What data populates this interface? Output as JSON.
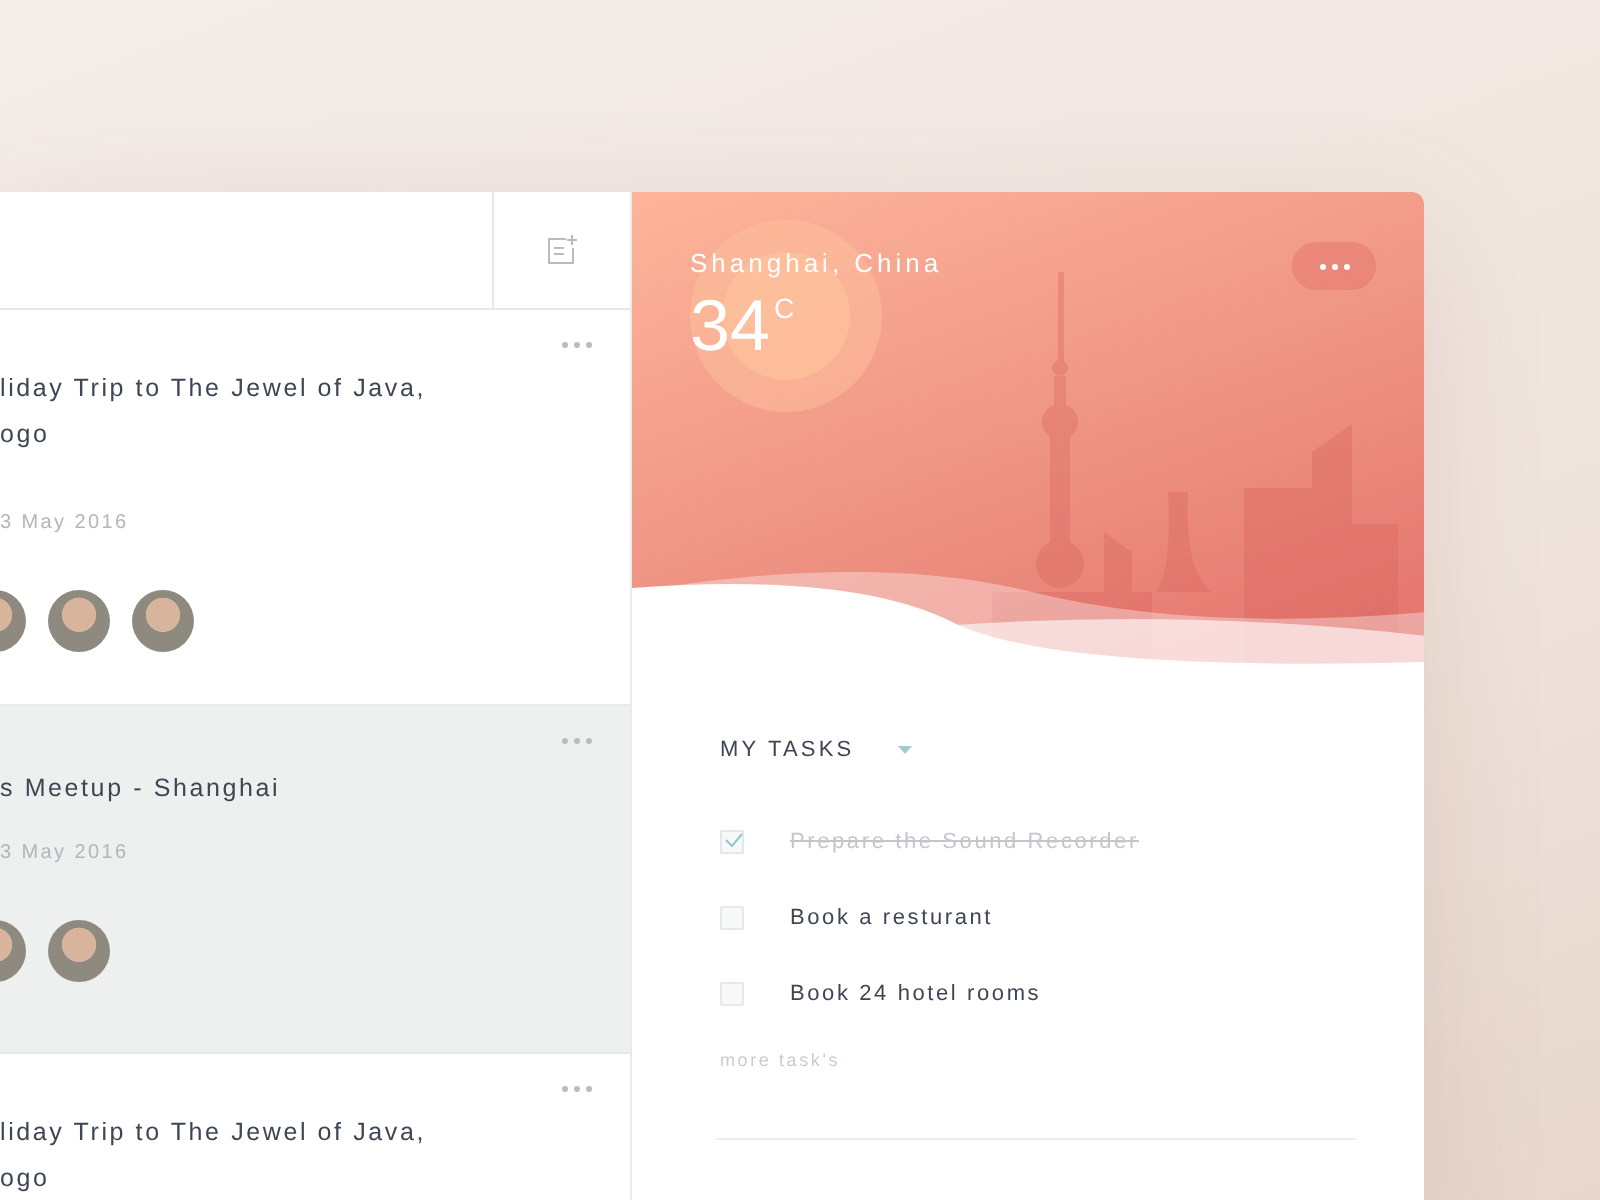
{
  "events_panel": {
    "events": [
      {
        "title_lines": [
          "liday Trip to The Jewel of Java,",
          "ogo"
        ],
        "date": "3 May 2016",
        "selected": false,
        "avatars": [
          {
            "kind": "photo"
          },
          {
            "kind": "photo"
          },
          {
            "kind": "photo"
          }
        ]
      },
      {
        "title_lines": [
          "s Meetup - Shanghai"
        ],
        "date": "3 May 2016",
        "selected": true,
        "avatars": [
          {
            "kind": "photo"
          },
          {
            "kind": "photo"
          }
        ]
      },
      {
        "title_lines": [
          "liday Trip to The Jewel of Java,",
          "ogo"
        ],
        "selected": false
      }
    ]
  },
  "weather": {
    "city": "Shanghai, China",
    "temperature": "34",
    "unit": "C"
  },
  "tasks": {
    "heading": "MY TASKS",
    "items": [
      {
        "label": "Prepare the Sound Recorder",
        "checked": true
      },
      {
        "label": "Book a resturant",
        "checked": false
      },
      {
        "label": "Book 24 hotel rooms",
        "checked": false
      }
    ],
    "more_link": "more task's"
  }
}
